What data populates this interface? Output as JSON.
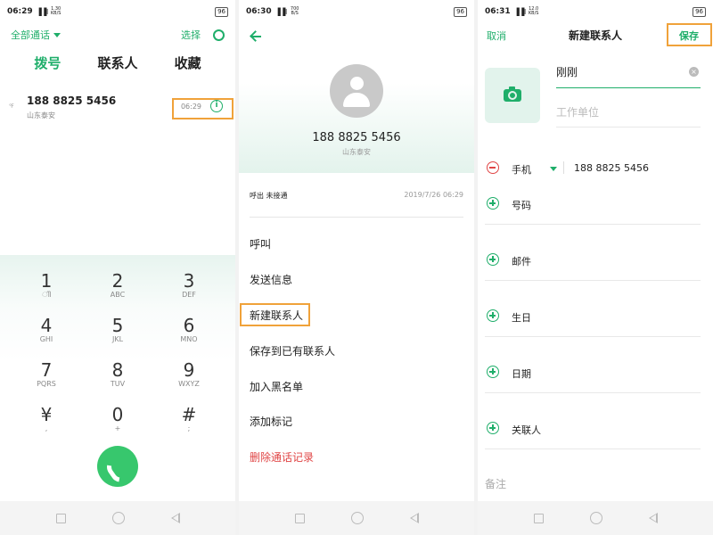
{
  "screen1": {
    "status": {
      "time": "06:29",
      "signal": "▐▐l",
      "speed_val": "1.30",
      "speed_unit": "KB/S",
      "battery": "96"
    },
    "filter_label": "全部通话",
    "select_label": "选择",
    "tabs": [
      {
        "label": "拨号"
      },
      {
        "label": "联系人"
      },
      {
        "label": "收藏"
      }
    ],
    "call_log": [
      {
        "number": "188 8825 5456",
        "location": "山东泰安",
        "time": "06:29",
        "tiny": "℉"
      }
    ],
    "keys": [
      {
        "digit": "1",
        "letters": "ിി"
      },
      {
        "digit": "2",
        "letters": "ABC"
      },
      {
        "digit": "3",
        "letters": "DEF"
      },
      {
        "digit": "4",
        "letters": "GHI"
      },
      {
        "digit": "5",
        "letters": "JKL"
      },
      {
        "digit": "6",
        "letters": "MNO"
      },
      {
        "digit": "7",
        "letters": "PQRS"
      },
      {
        "digit": "8",
        "letters": "TUV"
      },
      {
        "digit": "9",
        "letters": "WXYZ"
      },
      {
        "digit": "¥",
        "letters": ","
      },
      {
        "digit": "0",
        "letters": "+"
      },
      {
        "digit": "#",
        "letters": ";"
      }
    ],
    "info_glyph": "i"
  },
  "screen2": {
    "status": {
      "time": "06:30",
      "signal": "▐▐l",
      "speed_val": "700",
      "speed_unit": "B/S",
      "battery": "96"
    },
    "number": "188 8825 5456",
    "location": "山东泰安",
    "log_type": "呼出 未接通",
    "log_time": "2019/7/26 06:29",
    "menu": [
      {
        "label": "呼叫"
      },
      {
        "label": "发送信息"
      },
      {
        "label": "新建联系人"
      },
      {
        "label": "保存到已有联系人"
      },
      {
        "label": "加入黑名单"
      },
      {
        "label": "添加标记"
      },
      {
        "label": "删除通话记录"
      }
    ]
  },
  "screen3": {
    "status": {
      "time": "06:31",
      "signal": "▐▐l",
      "speed_val": "12.0",
      "speed_unit": "KB/S",
      "battery": "96"
    },
    "cancel_label": "取消",
    "title": "新建联系人",
    "save_label": "保存",
    "name_value": "刚刚",
    "company_placeholder": "工作单位",
    "phone_label": "手机",
    "phone_value": "188 8825 5456",
    "fields": [
      {
        "label": "号码"
      },
      {
        "label": "邮件"
      },
      {
        "label": "生日"
      },
      {
        "label": "日期"
      },
      {
        "label": "关联人"
      }
    ],
    "note_label": "备注",
    "clear_glyph": "×"
  },
  "colors": {
    "accent": "#1fae6a",
    "highlight": "#f0a23a",
    "danger": "#e04545"
  }
}
